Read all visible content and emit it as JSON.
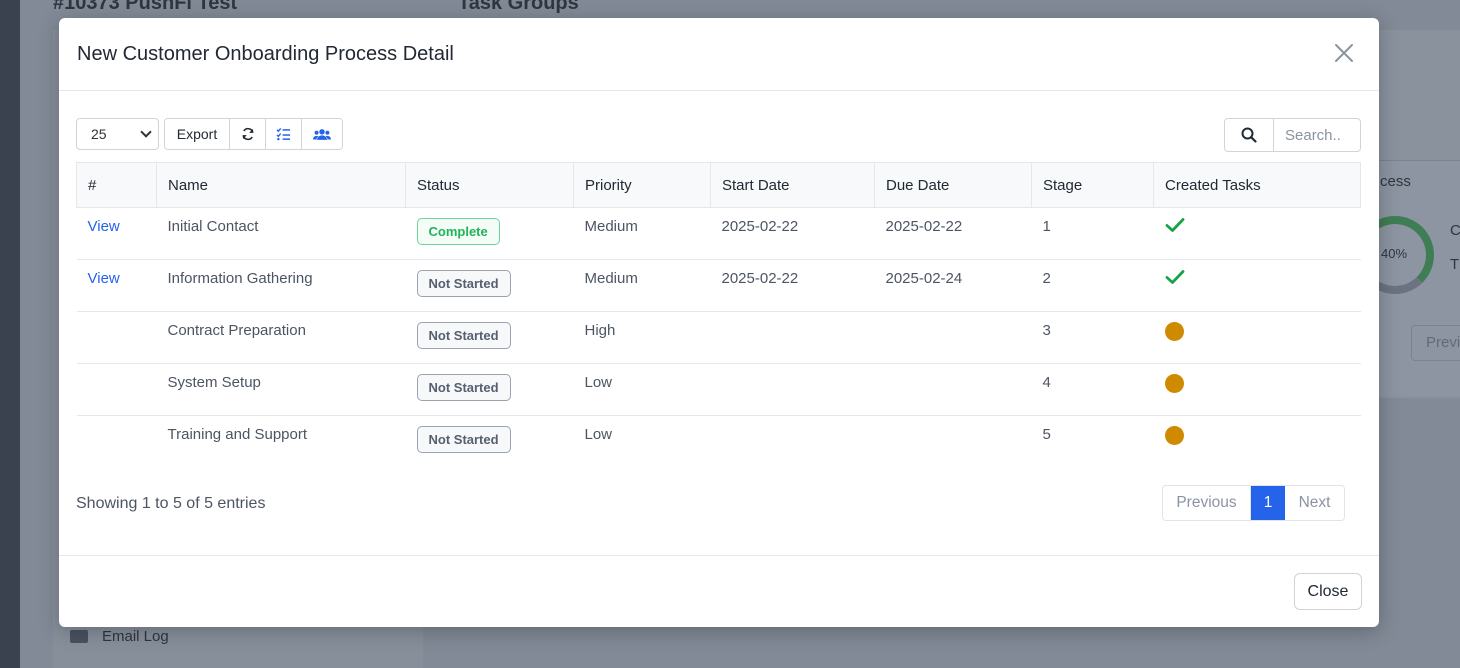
{
  "background": {
    "left_title": "#10373 PushFi Test",
    "right_title": "Task Groups",
    "process_label": "cess",
    "donut_label": "40%",
    "side_c": "C",
    "side_t": "T",
    "prev_label": "Previ",
    "email_log_label": "Email Log"
  },
  "modal": {
    "title": "New Customer Onboarding Process Detail",
    "page_length": "25",
    "export_label": "Export",
    "search_placeholder": "Search..",
    "columns": [
      "#",
      "Name",
      "Status",
      "Priority",
      "Start Date",
      "Due Date",
      "Stage",
      "Created Tasks"
    ],
    "rows": [
      {
        "link": "View",
        "name": "Initial Contact",
        "status": "Complete",
        "priority": "Medium",
        "start": "2025-02-22",
        "due": "2025-02-22",
        "stage": "1",
        "created": "check"
      },
      {
        "link": "View",
        "name": "Information Gathering",
        "status": "Not Started",
        "priority": "Medium",
        "start": "2025-02-22",
        "due": "2025-02-24",
        "stage": "2",
        "created": "check"
      },
      {
        "link": "",
        "name": "Contract Preparation",
        "status": "Not Started",
        "priority": "High",
        "start": "",
        "due": "",
        "stage": "3",
        "created": "pending"
      },
      {
        "link": "",
        "name": "System Setup",
        "status": "Not Started",
        "priority": "Low",
        "start": "",
        "due": "",
        "stage": "4",
        "created": "pending"
      },
      {
        "link": "",
        "name": "Training and Support",
        "status": "Not Started",
        "priority": "Low",
        "start": "",
        "due": "",
        "stage": "5",
        "created": "pending"
      }
    ],
    "info": "Showing 1 to 5 of 5 entries",
    "pager": {
      "previous": "Previous",
      "current": "1",
      "next": "Next"
    },
    "close_label": "Close"
  },
  "colors": {
    "accent": "#2563eb",
    "success": "#16a34a",
    "pending": "#d08a00"
  }
}
